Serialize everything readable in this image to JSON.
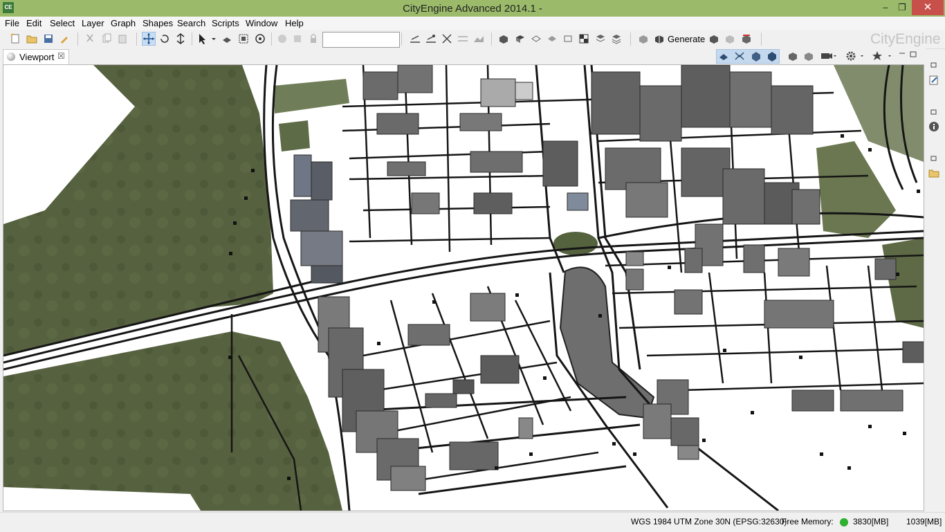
{
  "window": {
    "title": "CityEngine Advanced 2014.1 -",
    "app_icon": "CE",
    "minimize": "–",
    "restore": "❐",
    "close": "✕"
  },
  "menu": [
    "File",
    "Edit",
    "Select",
    "Layer",
    "Graph",
    "Shapes",
    "Search",
    "Scripts",
    "Window",
    "Help"
  ],
  "toolbar": {
    "generate_label": "Generate",
    "brand": "CityEngine",
    "search_value": ""
  },
  "tab": {
    "label": "Viewport",
    "close": "☒"
  },
  "status": {
    "crs": "WGS 1984 UTM Zone 30N (EPSG:32630)",
    "free_memory_label": "Free Memory:",
    "free_memory": "3830[MB]",
    "total_memory": "1039[MB]",
    "memory_status_color": "#2fb02f"
  },
  "colors": {
    "titlebar": "#9bbb6a",
    "close": "#c7504b",
    "terrain": "#4f5a3a"
  }
}
